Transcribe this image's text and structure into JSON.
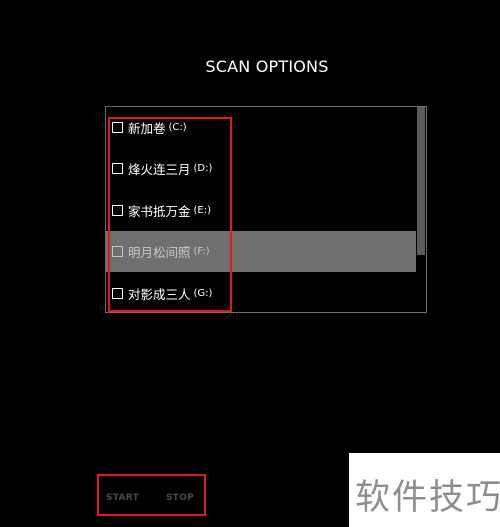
{
  "dialog": {
    "title": "SCAN OPTIONS"
  },
  "drives": [
    {
      "name": "新加卷",
      "letter": "(C:)",
      "checked": false,
      "selected": false
    },
    {
      "name": "烽火连三月",
      "letter": "(D:)",
      "checked": false,
      "selected": false
    },
    {
      "name": "家书抵万金",
      "letter": "(E:)",
      "checked": false,
      "selected": false
    },
    {
      "name": "明月松间照",
      "letter": "(F:)",
      "checked": false,
      "selected": true
    },
    {
      "name": "对影成三人",
      "letter": "(G:)",
      "checked": false,
      "selected": false
    }
  ],
  "buttons": {
    "start_label": "START",
    "stop_label": "STOP"
  },
  "watermark": {
    "text": "软件技巧"
  },
  "colors": {
    "background": "#000000",
    "text": "#ffffff",
    "selected_row": "#6f6f6f",
    "annotation_red": "#e0191e",
    "disabled_button": "#4a4a4a"
  }
}
